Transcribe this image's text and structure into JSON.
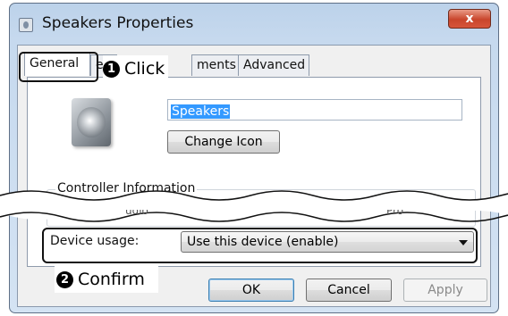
{
  "window": {
    "title": "Speakers Properties",
    "close_label": "x"
  },
  "tabs": [
    {
      "label": "General",
      "active": true
    },
    {
      "label": "e",
      "active": false
    },
    {
      "label": "ments",
      "active": false
    },
    {
      "label": "Advanced",
      "active": false
    }
  ],
  "annotations": {
    "step1_number": "1",
    "step1_text": "Click",
    "step2_number": "2",
    "step2_text": "Confirm"
  },
  "general": {
    "device_name": "Speakers",
    "change_icon_label": "Change Icon",
    "controller_group_label": "Controller Information",
    "controller_partial_left": "udio",
    "controller_partial_right": "Pro",
    "device_usage_label": "Device usage:",
    "device_usage_value": "Use this device (enable)"
  },
  "buttons": {
    "ok": "OK",
    "cancel": "Cancel",
    "apply": "Apply"
  }
}
